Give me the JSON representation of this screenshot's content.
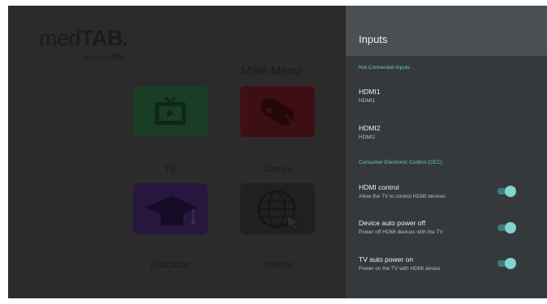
{
  "home": {
    "logo": {
      "main_light": "med",
      "main_bold": "TAB",
      "powered_prefix": "powered by",
      "powered_brand": "PDi"
    },
    "menu_title": "Main Menu",
    "tiles": [
      {
        "label": "TV",
        "icon": "tv-icon",
        "color": "#1a3d25"
      },
      {
        "label": "Games",
        "icon": "gamepad-icon",
        "color": "#3d0f14"
      },
      {
        "label": "Education",
        "icon": "graduation-cap-icon",
        "color": "#27173f"
      },
      {
        "label": "Internet",
        "icon": "globe-cursor-icon",
        "color": "#202020"
      }
    ]
  },
  "panel": {
    "title": "Inputs",
    "sections": {
      "not_connected": "Not Connected Inputs",
      "cec": "Consumer Electronic Control (CEC)"
    },
    "inputs": [
      {
        "title": "HDMI1",
        "subtitle": "HDMI1"
      },
      {
        "title": "HDMI2",
        "subtitle": "HDMI2"
      }
    ],
    "cec_settings": [
      {
        "title": "HDMI control",
        "subtitle": "Allow the TV to control HDMI devices",
        "enabled": true
      },
      {
        "title": "Device auto power off",
        "subtitle": "Power off HDMI devices with the TV",
        "enabled": true
      },
      {
        "title": "TV auto power on",
        "subtitle": "Power on the TV with HDMI device",
        "enabled": true
      }
    ]
  },
  "colors": {
    "accent": "#69c7c4",
    "toggle_thumb": "#7fd5cf",
    "panel_bg": "#35393c",
    "panel_header": "#4a4f53"
  }
}
